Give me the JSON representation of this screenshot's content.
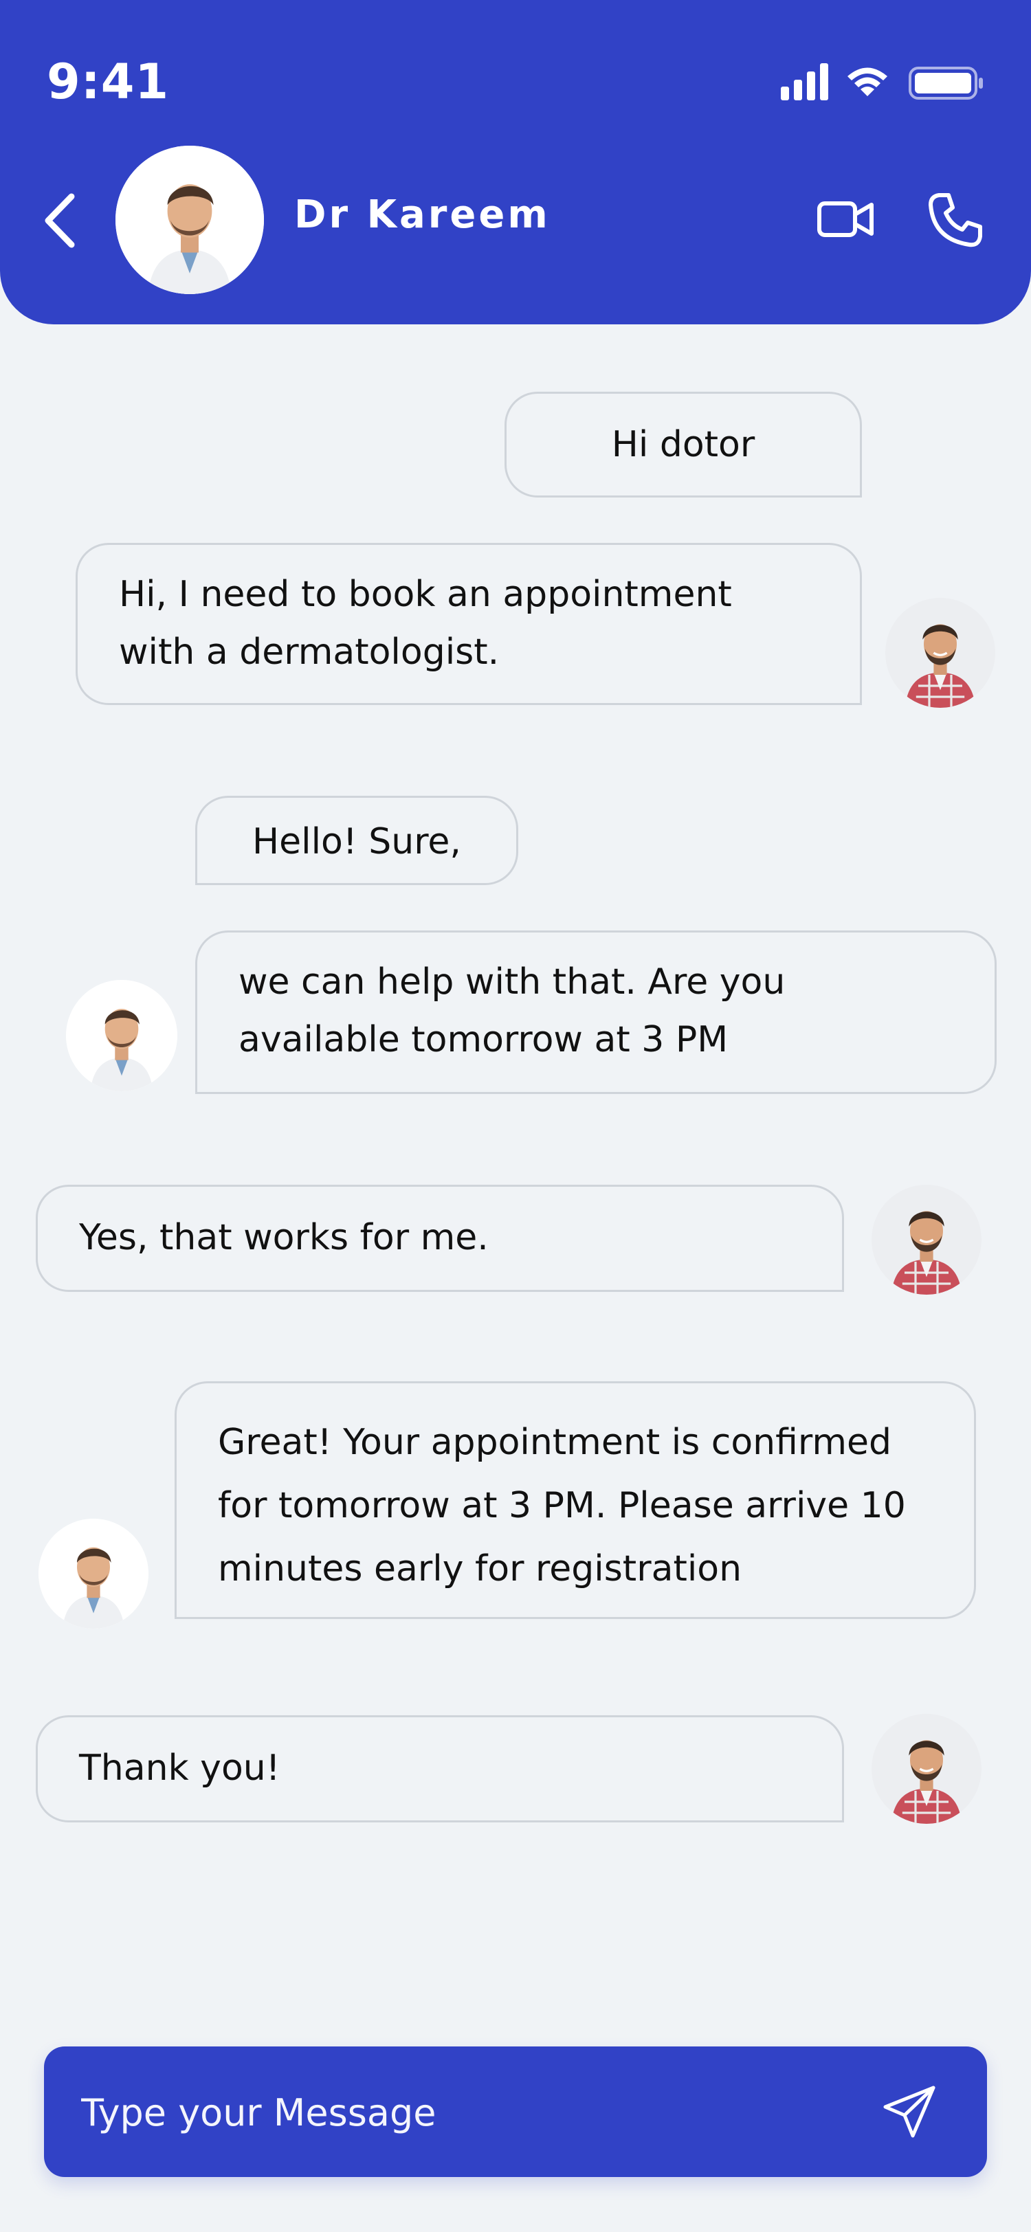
{
  "status": {
    "time": "9:41"
  },
  "header": {
    "doctor_name": "Dr Kareem"
  },
  "messages": [
    {
      "text": "Hi dotor"
    },
    {
      "text": "Hi, I need to book an appointment with a dermatologist."
    },
    {
      "text": "Hello! Sure,"
    },
    {
      "text": "we can help with that. Are you available tomorrow at 3 PM"
    },
    {
      "text": "Yes, that works for me."
    },
    {
      "text": "Great! Your appointment is confirmed for tomorrow at 3 PM. Please arrive 10 minutes early for registration"
    },
    {
      "text": "Thank you!"
    }
  ],
  "composer": {
    "placeholder": "Type your Message"
  },
  "colors": {
    "accent": "#3142c6",
    "background": "#f0f3f6",
    "bubble_border": "#cfd4da"
  },
  "icons": [
    "signal-icon",
    "wifi-icon",
    "battery-icon",
    "back-arrow-icon",
    "video-camera-icon",
    "phone-icon",
    "send-icon"
  ]
}
